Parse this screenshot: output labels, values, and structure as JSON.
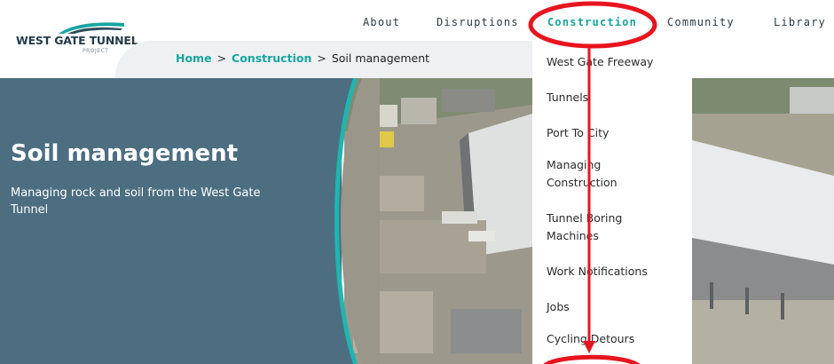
{
  "logo": {
    "title": "WEST GATE TUNNEL",
    "subtitle": "PROJECT"
  },
  "nav": {
    "items": [
      {
        "label": "About"
      },
      {
        "label": "Disruptions"
      },
      {
        "label": "Construction"
      },
      {
        "label": "Community"
      },
      {
        "label": "Library"
      }
    ],
    "active": "Construction"
  },
  "breadcrumb": {
    "home": "Home",
    "parent": "Construction",
    "separator": ">",
    "current": "Soil management"
  },
  "hero": {
    "title": "Soil management",
    "subtitle": "Managing rock and soil from the West Gate Tunnel"
  },
  "dropdown": {
    "items": [
      {
        "label": "West Gate Freeway"
      },
      {
        "label": "Tunnels"
      },
      {
        "label": "Port To City"
      },
      {
        "label": "Managing Construction"
      },
      {
        "label": "Tunnel Boring Machines"
      },
      {
        "label": "Work Notifications"
      },
      {
        "label": "Jobs"
      },
      {
        "label": "Cycling Detours"
      }
    ]
  },
  "colors": {
    "accent": "#16a5a0",
    "hero_panel": "#4c6e80",
    "annotation_red": "#e8141e"
  },
  "icons": {
    "logo_mark": "swoosh-logo-icon",
    "arrow": "down-arrow-annotation"
  }
}
